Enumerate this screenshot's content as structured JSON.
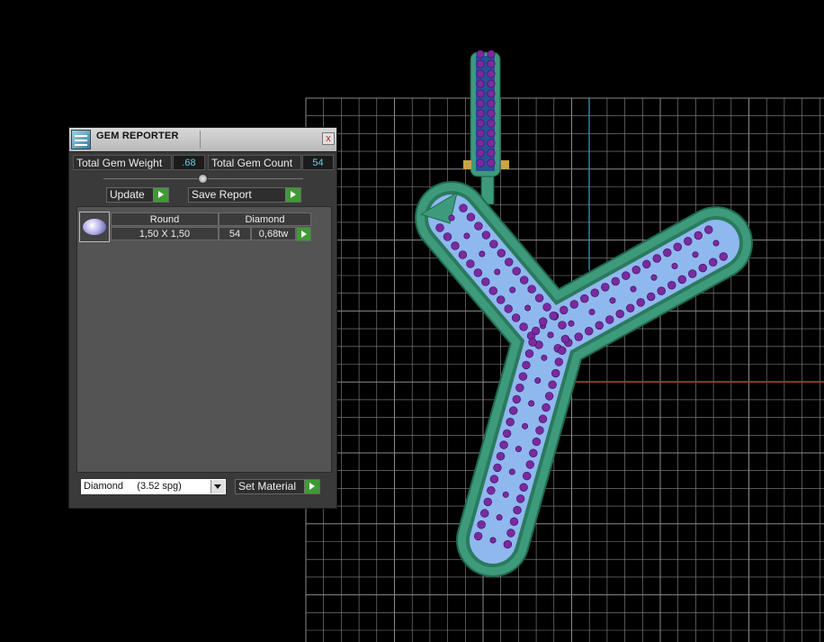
{
  "panel": {
    "title": "GEM REPORTER",
    "close_glyph": "x",
    "icon": "gem-reporter-app-icon",
    "total_gem_weight_label": "Total Gem Weight",
    "total_gem_weight_value": ".68",
    "total_gem_count_label": "Total Gem Count",
    "total_gem_count_value": "54",
    "update_label": "Update",
    "save_report_label": "Save Report",
    "gems": [
      {
        "shape": "Round",
        "material": "Diamond",
        "size": "1,50 X 1,50",
        "count": "54",
        "weight": "0,68tw"
      }
    ],
    "material_select": {
      "value": "Diamond     (3.52 spg)"
    },
    "set_material_label": "Set Material"
  },
  "viewport": {
    "grid_color": "#8a8a8a",
    "x_axis_color": "#c0302a",
    "y_axis_color": "#3aa0c0",
    "metal_color": "#3d9a7a",
    "gem_setting_color": "#8fb8ef",
    "gem_color": "#7a2aa0"
  }
}
